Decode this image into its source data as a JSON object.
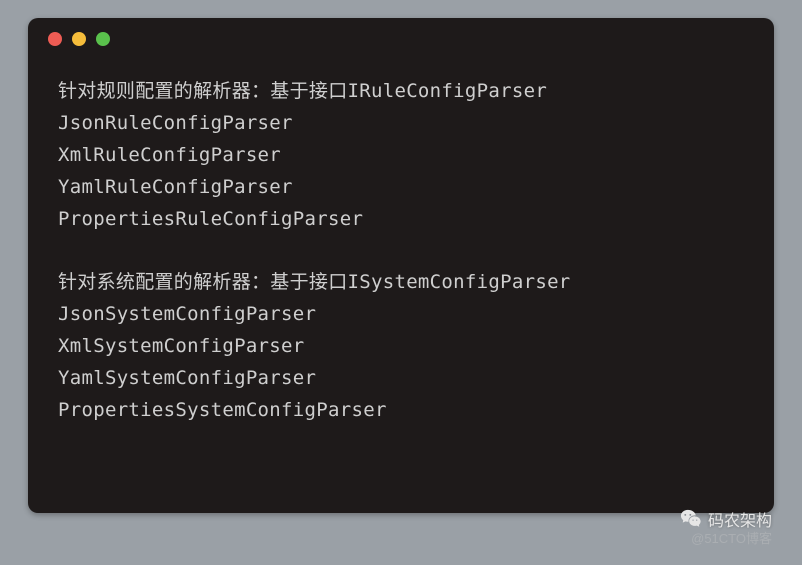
{
  "code": {
    "lines": [
      "针对规则配置的解析器：基于接口IRuleConfigParser",
      "JsonRuleConfigParser",
      "XmlRuleConfigParser",
      "YamlRuleConfigParser",
      "PropertiesRuleConfigParser",
      "",
      "针对系统配置的解析器：基于接口ISystemConfigParser",
      "JsonSystemConfigParser",
      "XmlSystemConfigParser",
      "YamlSystemConfigParser",
      "PropertiesSystemConfigParser"
    ]
  },
  "watermark": {
    "wechat_label": "码农架构",
    "cto_label": "@51CTO博客"
  }
}
